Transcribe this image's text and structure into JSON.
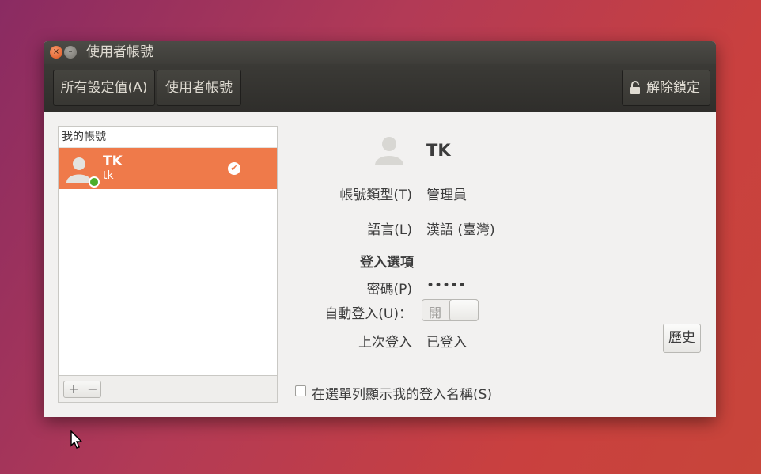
{
  "window": {
    "title": "使用者帳號",
    "close_glyph": "×",
    "minimize_glyph": "–"
  },
  "toolbar": {
    "all_settings_label": "所有設定值(A)",
    "user_accounts_label": "使用者帳號",
    "unlock_label": "解除鎖定"
  },
  "sidebar": {
    "header": "我的帳號",
    "users": [
      {
        "name": "TK",
        "login": "tk",
        "online": true,
        "current": true
      }
    ],
    "add_label": "+",
    "remove_label": "−"
  },
  "details": {
    "user_name": "TK",
    "account_type_label": "帳號類型(T)",
    "account_type_value": "管理員",
    "language_label": "語言(L)",
    "language_value": "漢語 (臺灣)",
    "login_options_heading": "登入選項",
    "password_label": "密碼(P)",
    "password_value": "•••••",
    "auto_login_label": "自動登入(U)：",
    "auto_login_switch_text": "開",
    "auto_login_enabled": false,
    "last_login_label": "上次登入",
    "last_login_value": "已登入",
    "history_button_label": "歷史",
    "show_name_checkbox_label": "在選單列顯示我的登入名稱(S)",
    "show_name_checked": false
  },
  "colors": {
    "selection": "#ef7a4a",
    "online": "#4cae2a",
    "window_bg": "#f2f1f0",
    "header_bar": "#3b3a36"
  },
  "icons": [
    "close-icon",
    "minimize-icon",
    "lock-icon",
    "avatar-icon",
    "check-icon",
    "pointer-cursor-icon"
  ]
}
